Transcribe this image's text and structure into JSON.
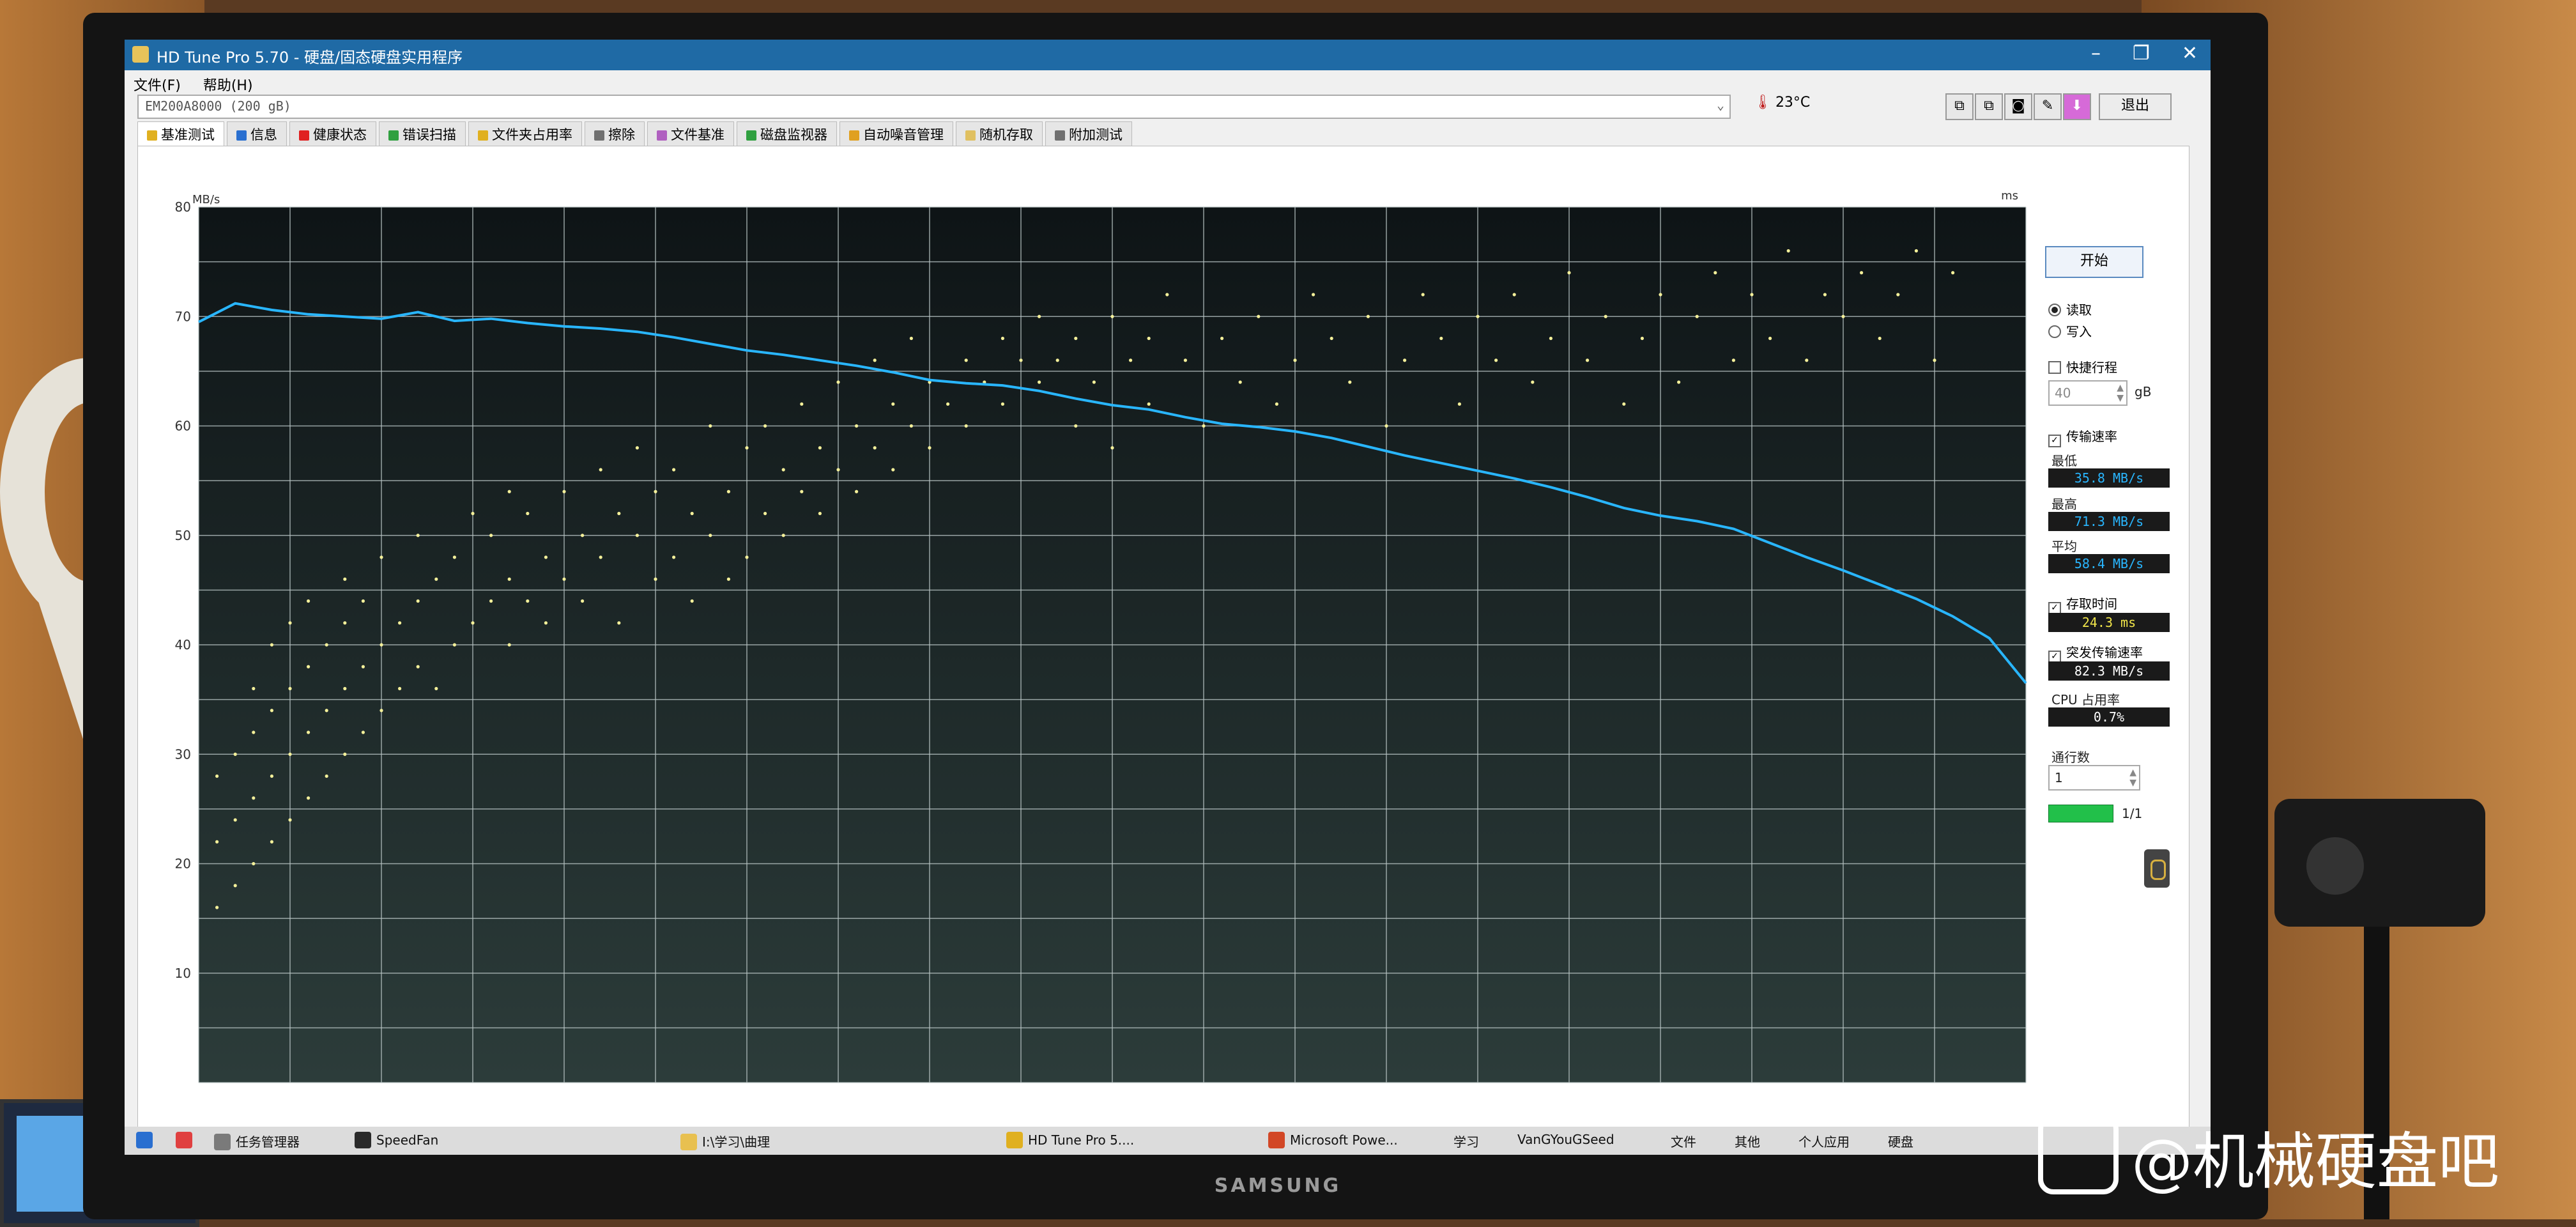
{
  "window": {
    "title": "HD Tune Pro 5.70 - 硬盘/固态硬盘实用程序",
    "controls": [
      "–",
      "❐",
      "✕"
    ]
  },
  "menu": [
    "文件(F)",
    "帮助(H)"
  ],
  "drive": {
    "selected": "EM200A8000 (200 gB)"
  },
  "temperature": "23°C",
  "toolbar": {
    "exit_label": "退出"
  },
  "tabs": [
    {
      "label": "基准测试",
      "color": "#e0b020"
    },
    {
      "label": "信息",
      "color": "#2a6fd0"
    },
    {
      "label": "健康状态",
      "color": "#e02020"
    },
    {
      "label": "错误扫描",
      "color": "#30a040"
    },
    {
      "label": "文件夹占用率",
      "color": "#e0b020"
    },
    {
      "label": "擦除",
      "color": "#707070"
    },
    {
      "label": "文件基准",
      "color": "#b060c0"
    },
    {
      "label": "磁盘监视器",
      "color": "#30a040"
    },
    {
      "label": "自动噪音管理",
      "color": "#e0a020"
    },
    {
      "label": "随机存取",
      "color": "#e0c060"
    },
    {
      "label": "附加测试",
      "color": "#707070"
    }
  ],
  "side": {
    "start_label": "开始",
    "read_label": "读取",
    "write_label": "写入",
    "short_stroke_label": "快捷行程",
    "short_stroke_value": "40",
    "short_stroke_unit": "gB",
    "transfer_rate_label": "传输速率",
    "min_label": "最低",
    "min_value": "35.8 MB/s",
    "max_label": "最高",
    "max_value": "71.3 MB/s",
    "avg_label": "平均",
    "avg_value": "58.4 MB/s",
    "access_time_label": "存取时间",
    "access_time_value": "24.3 ms",
    "burst_label": "突发传输速率",
    "burst_value": "82.3 MB/s",
    "cpu_label": "CPU 占用率",
    "cpu_value": "0.7%",
    "passes_label": "通行数",
    "passes_value": "1",
    "progress_text": "1/1",
    "progress_fraction": 1.0
  },
  "taskbar": {
    "items": [
      "任务管理器",
      "SpeedFan",
      "I:\\学习\\曲理",
      "HD Tune Pro 5....",
      "Microsoft Powe...",
      "学习",
      "VanGYouGSeed",
      "文件",
      "其他",
      "个人应用",
      "硬盘"
    ]
  },
  "monitor_brand": "SAMSUNG",
  "watermark": "@机械硬盘吧",
  "chart_data": {
    "type": "line",
    "y_left_unit": "MB/s",
    "y_right_unit": "ms",
    "ylim_left": [
      0,
      80
    ],
    "ylim_right": [
      0,
      40
    ],
    "left_ticks": [
      10,
      20,
      30,
      40,
      50,
      60,
      70,
      80
    ],
    "right_ticks": [
      5,
      10,
      15,
      20,
      25,
      30,
      35,
      40
    ],
    "grid": true,
    "xlim": [
      0,
      100
    ],
    "series": [
      {
        "color": "#29b6ff",
        "x": [
          0,
          2,
          4,
          6,
          8,
          10,
          12,
          14,
          16,
          18,
          20,
          22,
          24,
          26,
          28,
          30,
          32,
          34,
          36,
          38,
          40,
          42,
          44,
          46,
          48,
          50,
          52,
          54,
          56,
          58,
          60,
          62,
          64,
          66,
          68,
          70,
          72,
          74,
          76,
          78,
          80,
          82,
          84,
          86,
          88,
          90,
          92,
          94,
          96,
          98,
          100
        ],
        "y": [
          69.5,
          71.2,
          70.6,
          70.2,
          70.0,
          69.8,
          70.4,
          69.6,
          69.8,
          69.4,
          69.1,
          68.9,
          68.6,
          68.1,
          67.5,
          66.9,
          66.5,
          66.0,
          65.5,
          64.9,
          64.2,
          63.9,
          63.7,
          63.2,
          62.5,
          61.9,
          61.5,
          60.8,
          60.2,
          59.9,
          59.5,
          58.9,
          58.1,
          57.3,
          56.6,
          55.9,
          55.2,
          54.4,
          53.5,
          52.5,
          51.8,
          51.3,
          50.6,
          49.3,
          48.0,
          46.8,
          45.5,
          44.2,
          42.6,
          40.6,
          36.5
        ]
      }
    ],
    "access_time_points_ms": [
      [
        1,
        8
      ],
      [
        1,
        11
      ],
      [
        1,
        14
      ],
      [
        2,
        9
      ],
      [
        2,
        12
      ],
      [
        2,
        15
      ],
      [
        3,
        10
      ],
      [
        3,
        13
      ],
      [
        3,
        16
      ],
      [
        3,
        18
      ],
      [
        4,
        11
      ],
      [
        4,
        14
      ],
      [
        4,
        17
      ],
      [
        4,
        20
      ],
      [
        5,
        12
      ],
      [
        5,
        15
      ],
      [
        5,
        18
      ],
      [
        5,
        21
      ],
      [
        6,
        13
      ],
      [
        6,
        16
      ],
      [
        6,
        19
      ],
      [
        6,
        22
      ],
      [
        7,
        14
      ],
      [
        7,
        17
      ],
      [
        7,
        20
      ],
      [
        8,
        15
      ],
      [
        8,
        18
      ],
      [
        8,
        21
      ],
      [
        8,
        23
      ],
      [
        9,
        16
      ],
      [
        9,
        19
      ],
      [
        9,
        22
      ],
      [
        10,
        17
      ],
      [
        10,
        20
      ],
      [
        10,
        24
      ],
      [
        11,
        18
      ],
      [
        11,
        21
      ],
      [
        12,
        19
      ],
      [
        12,
        22
      ],
      [
        12,
        25
      ],
      [
        13,
        18
      ],
      [
        13,
        23
      ],
      [
        14,
        20
      ],
      [
        14,
        24
      ],
      [
        15,
        21
      ],
      [
        15,
        26
      ],
      [
        16,
        22
      ],
      [
        16,
        25
      ],
      [
        17,
        20
      ],
      [
        17,
        23
      ],
      [
        17,
        27
      ],
      [
        18,
        22
      ],
      [
        18,
        26
      ],
      [
        19,
        21
      ],
      [
        19,
        24
      ],
      [
        20,
        23
      ],
      [
        20,
        27
      ],
      [
        21,
        22
      ],
      [
        21,
        25
      ],
      [
        22,
        24
      ],
      [
        22,
        28
      ],
      [
        23,
        21
      ],
      [
        23,
        26
      ],
      [
        24,
        25
      ],
      [
        24,
        29
      ],
      [
        25,
        23
      ],
      [
        25,
        27
      ],
      [
        26,
        24
      ],
      [
        26,
        28
      ],
      [
        27,
        22
      ],
      [
        27,
        26
      ],
      [
        28,
        25
      ],
      [
        28,
        30
      ],
      [
        29,
        23
      ],
      [
        29,
        27
      ],
      [
        30,
        24
      ],
      [
        30,
        29
      ],
      [
        31,
        26
      ],
      [
        31,
        30
      ],
      [
        32,
        25
      ],
      [
        32,
        28
      ],
      [
        33,
        27
      ],
      [
        33,
        31
      ],
      [
        34,
        26
      ],
      [
        34,
        29
      ],
      [
        35,
        28
      ],
      [
        35,
        32
      ],
      [
        36,
        27
      ],
      [
        36,
        30
      ],
      [
        37,
        29
      ],
      [
        37,
        33
      ],
      [
        38,
        28
      ],
      [
        38,
        31
      ],
      [
        39,
        30
      ],
      [
        39,
        34
      ],
      [
        40,
        29
      ],
      [
        40,
        32
      ],
      [
        41,
        31
      ],
      [
        42,
        30
      ],
      [
        42,
        33
      ],
      [
        43,
        32
      ],
      [
        44,
        31
      ],
      [
        44,
        34
      ],
      [
        45,
        33
      ],
      [
        46,
        32
      ],
      [
        46,
        35
      ],
      [
        47,
        33
      ],
      [
        48,
        34
      ],
      [
        48,
        30
      ],
      [
        49,
        32
      ],
      [
        50,
        35
      ],
      [
        50,
        29
      ],
      [
        51,
        33
      ],
      [
        52,
        31
      ],
      [
        52,
        34
      ],
      [
        53,
        36
      ],
      [
        54,
        33
      ],
      [
        55,
        30
      ],
      [
        56,
        34
      ],
      [
        57,
        32
      ],
      [
        58,
        35
      ],
      [
        59,
        31
      ],
      [
        60,
        33
      ],
      [
        61,
        36
      ],
      [
        62,
        34
      ],
      [
        63,
        32
      ],
      [
        64,
        35
      ],
      [
        65,
        30
      ],
      [
        66,
        33
      ],
      [
        67,
        36
      ],
      [
        68,
        34
      ],
      [
        69,
        31
      ],
      [
        70,
        35
      ],
      [
        71,
        33
      ],
      [
        72,
        36
      ],
      [
        73,
        32
      ],
      [
        74,
        34
      ],
      [
        75,
        37
      ],
      [
        76,
        33
      ],
      [
        77,
        35
      ],
      [
        78,
        31
      ],
      [
        79,
        34
      ],
      [
        80,
        36
      ],
      [
        81,
        32
      ],
      [
        82,
        35
      ],
      [
        83,
        37
      ],
      [
        84,
        33
      ],
      [
        85,
        36
      ],
      [
        86,
        34
      ],
      [
        87,
        38
      ],
      [
        88,
        33
      ],
      [
        89,
        36
      ],
      [
        90,
        35
      ],
      [
        91,
        37
      ],
      [
        92,
        34
      ],
      [
        93,
        36
      ],
      [
        94,
        38
      ],
      [
        95,
        33
      ],
      [
        96,
        37
      ]
    ]
  }
}
